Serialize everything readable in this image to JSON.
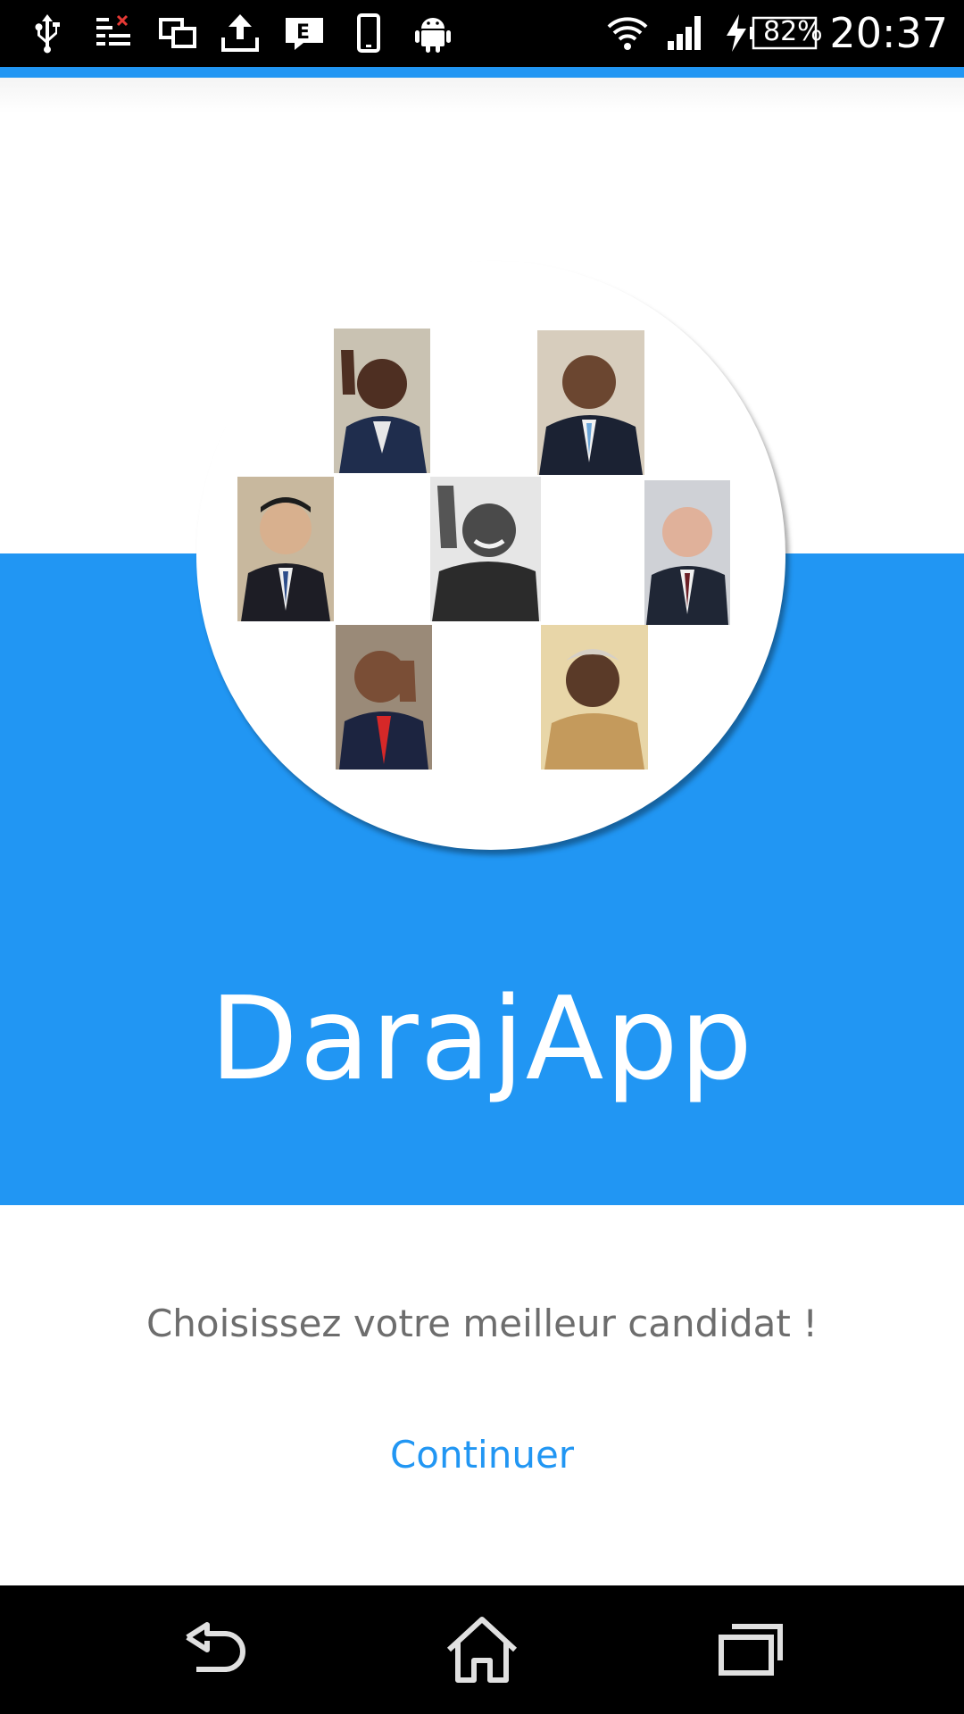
{
  "status_bar": {
    "icons": [
      "usb-icon",
      "sync-error-icon",
      "screen-mirror-icon",
      "upload-icon",
      "message-icon",
      "phone-icon",
      "android-icon"
    ],
    "right_icons": [
      "wifi-icon",
      "signal-icon",
      "charging-icon"
    ],
    "battery_level": "82%",
    "time": "20:37"
  },
  "colors": {
    "accent": "#2196F3",
    "status_bar": "#000000",
    "subtitle_text": "#6d6d6d"
  },
  "logo": {
    "portraits": [
      "portrait-1",
      "portrait-2",
      "portrait-3",
      "portrait-4",
      "portrait-5",
      "portrait-6",
      "portrait-7"
    ]
  },
  "app": {
    "title": "DarajApp",
    "subtitle": "Choisissez votre meilleur candidat !",
    "continue_label": "Continuer"
  },
  "nav_bar": {
    "buttons": [
      "back-icon",
      "home-icon",
      "recent-apps-icon"
    ]
  }
}
